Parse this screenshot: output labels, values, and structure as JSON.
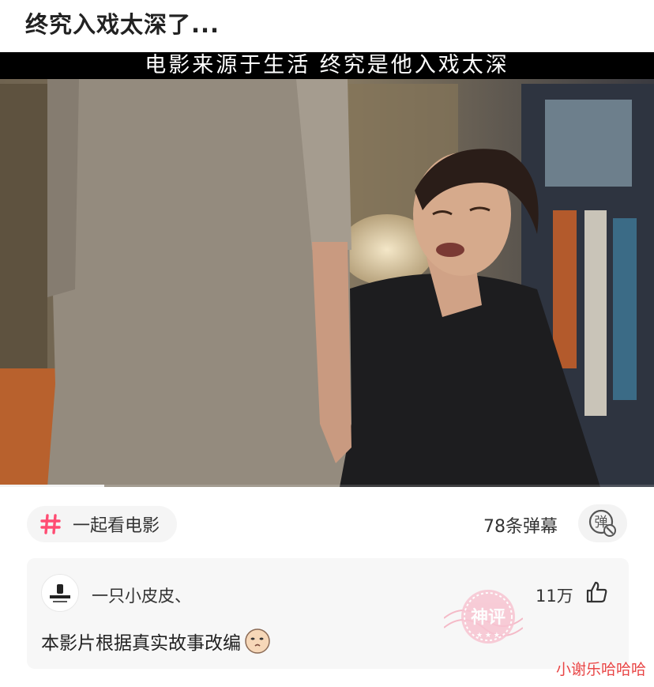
{
  "post": {
    "title": "终究入戏太深了..."
  },
  "video": {
    "subtitle": "电影来源于生活 终究是他入戏太深",
    "progress_fraction": 0.16,
    "scene": "two-actors-dim-bedroom"
  },
  "topic": {
    "label": "一起看电影",
    "icon": "hash-icon",
    "accent": "#ff4d73"
  },
  "danmaku": {
    "count_label": "78条弹幕",
    "toggle_icon": "danmaku-off-icon",
    "toggle_glyph": "弹"
  },
  "comment": {
    "user": "一只小皮皮、",
    "likes": "11万",
    "text": "本影片根据真实故事改编",
    "stamp_text": "神评",
    "emoji": "face-emoji"
  },
  "watermark": {
    "text": "小谢乐哈哈哈"
  },
  "colors": {
    "watermark": "#e84545",
    "stamp": "#f4a6b8",
    "card_bg": "#f7f7f7"
  }
}
